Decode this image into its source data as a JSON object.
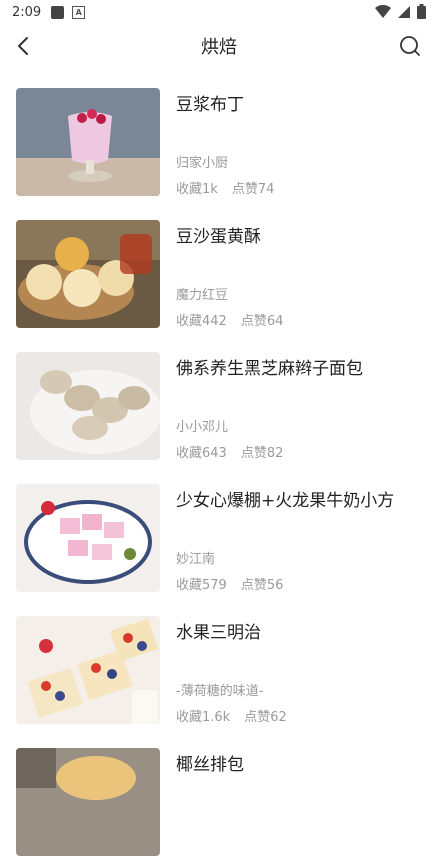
{
  "status": {
    "time": "2:09"
  },
  "header": {
    "title": "烘焙"
  },
  "recipes": [
    {
      "name": "豆浆布丁",
      "author": "归家小厨",
      "favorites": "收藏1k",
      "likes": "点赞74"
    },
    {
      "name": "豆沙蛋黄酥",
      "author": "魔力红豆",
      "favorites": "收藏442",
      "likes": "点赞64"
    },
    {
      "name": "佛系养生黑芝麻辫子面包",
      "author": "小小邓儿",
      "favorites": "收藏643",
      "likes": "点赞82"
    },
    {
      "name": "少女心爆棚+火龙果牛奶小方",
      "author": "妙江南",
      "favorites": "收藏579",
      "likes": "点赞56"
    },
    {
      "name": "水果三明治",
      "author": "-薄荷糖的味道-",
      "favorites": "收藏1.6k",
      "likes": "点赞62"
    },
    {
      "name": "椰丝排包",
      "author": "",
      "favorites": "",
      "likes": ""
    }
  ]
}
